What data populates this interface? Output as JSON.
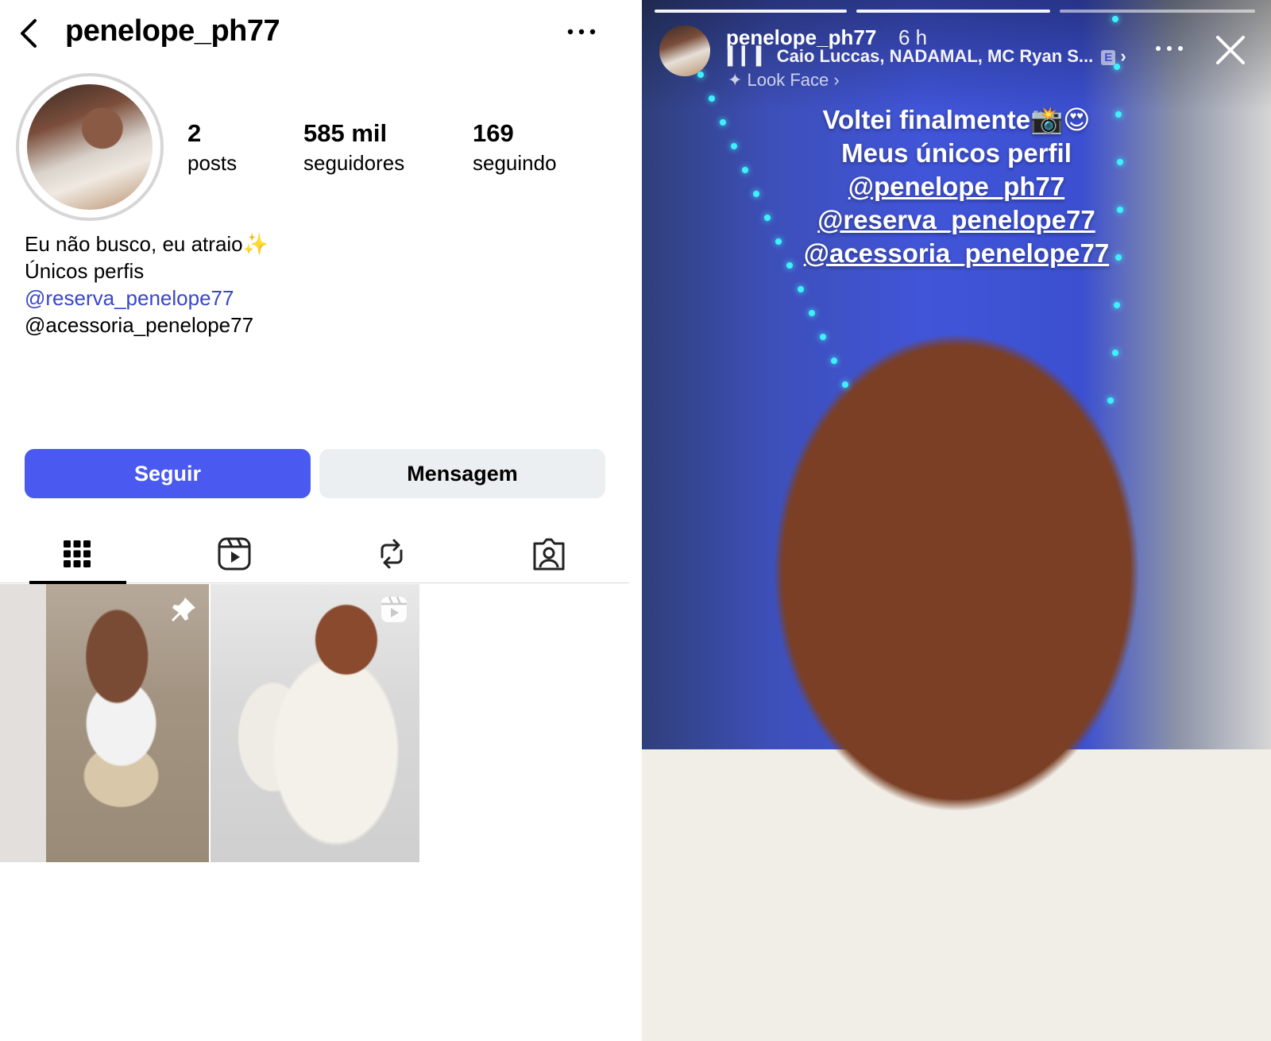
{
  "profile": {
    "username": "penelope_ph77",
    "stats": {
      "posts_count": "2",
      "posts_label": "posts",
      "followers_count": "585 mil",
      "followers_label": "seguidores",
      "following_count": "169",
      "following_label": "seguindo"
    },
    "bio": {
      "line1": "Eu não busco, eu atraio",
      "line1_emoji": "✨",
      "line2": "Únicos perfis",
      "link1": "@reserva_penelope77",
      "line4": "@acessoria_penelope77"
    },
    "buttons": {
      "follow": "Seguir",
      "message": "Mensagem"
    },
    "tabs": [
      "grid",
      "reels",
      "reposts",
      "tagged"
    ],
    "accent_color": "#4a5af0",
    "link_color": "#3946c9"
  },
  "story": {
    "username": "penelope_ph77",
    "time": "6 h",
    "music": "Caio Luccas, NADAMAL, MC Ryan S...",
    "explicit_badge": "E",
    "effect": "Look Face",
    "caption": {
      "line1": "Voltei finalmente📸😍",
      "line2": "Meus únicos perfil",
      "mention1": "@penelope_ph77",
      "mention2": "@reserva_penelope77",
      "mention3": "@acessoria_penelope77"
    }
  }
}
